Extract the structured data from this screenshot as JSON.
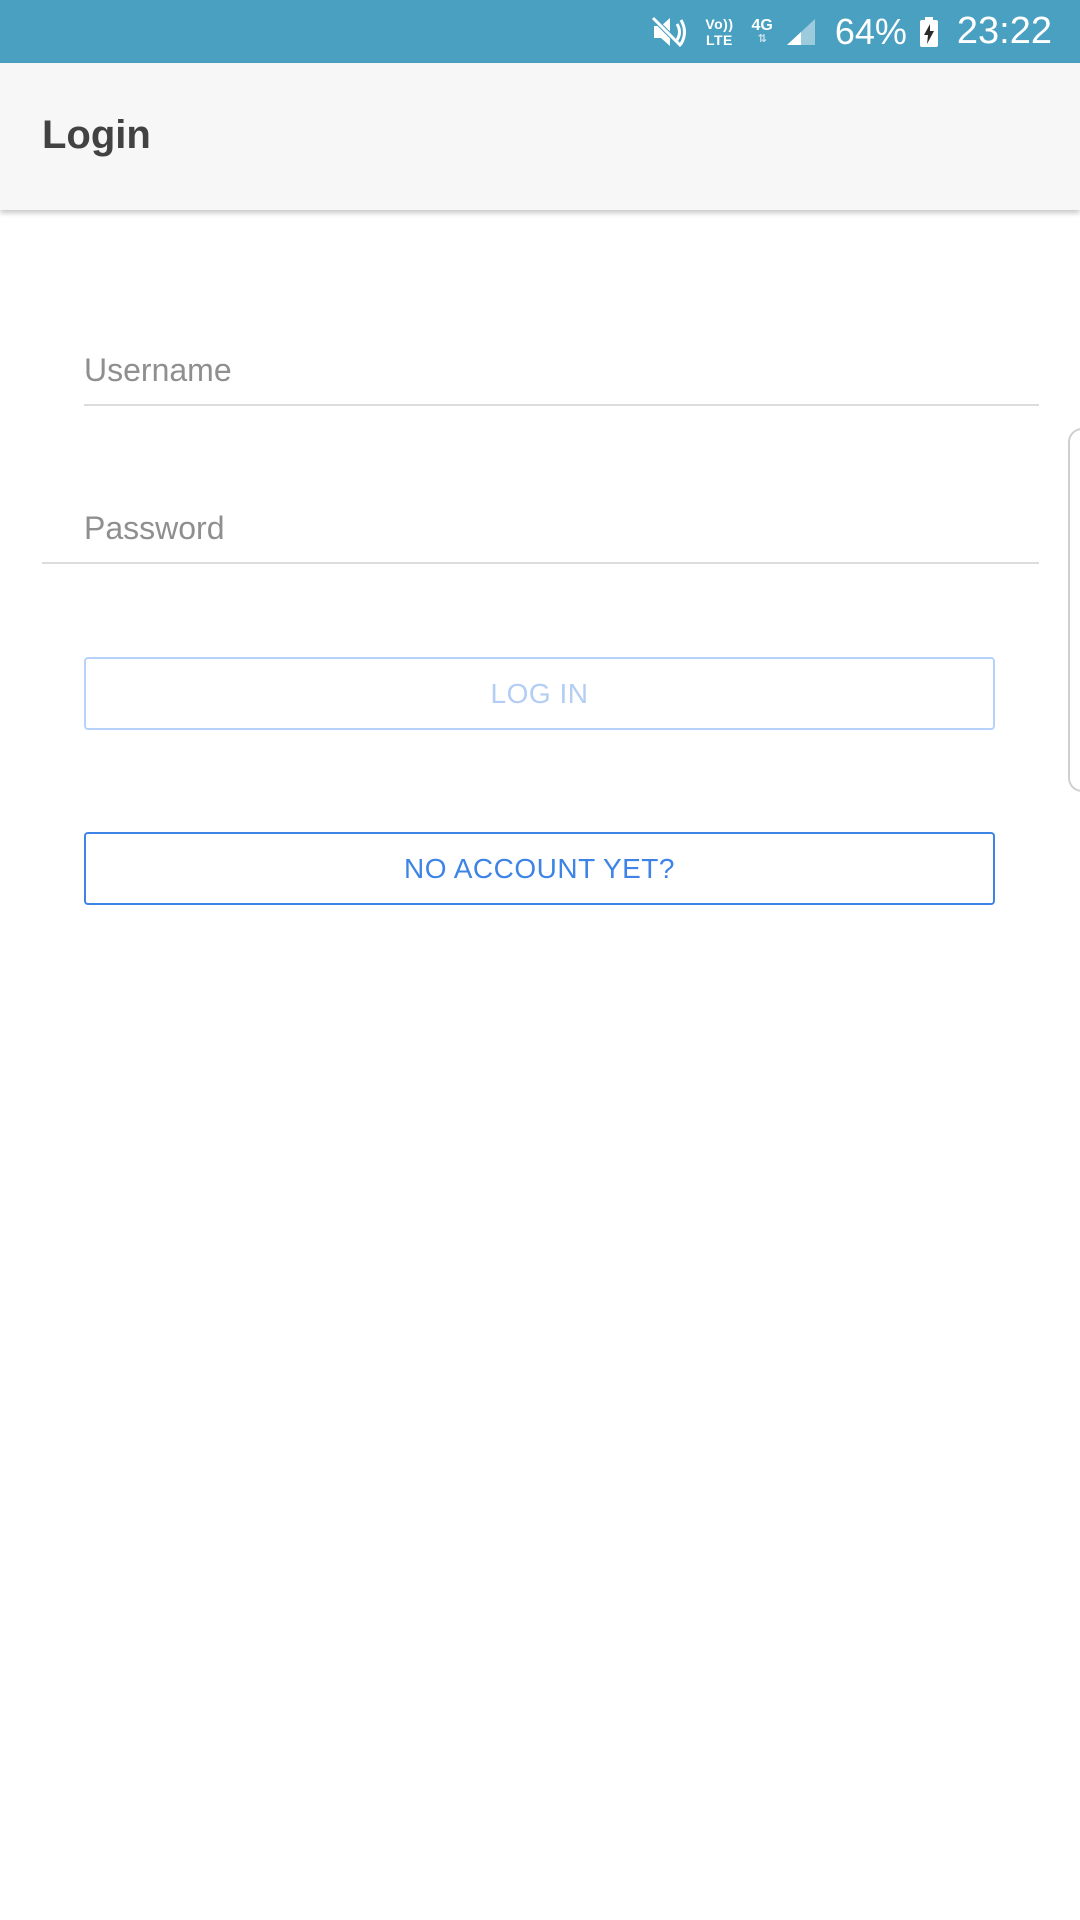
{
  "status_bar": {
    "volte_top": "Vo))",
    "volte_bottom": "LTE",
    "network": "4G",
    "network_arrows": "⇅",
    "battery": "64%",
    "time": "23:22",
    "color": "#4aa0c1"
  },
  "app_bar": {
    "title": "Login"
  },
  "form": {
    "username_placeholder": "Username",
    "username_value": "",
    "password_placeholder": "Password",
    "password_value": ""
  },
  "buttons": {
    "login_label": "LOG IN",
    "signup_label": "NO ACCOUNT YET?",
    "accent_color": "#3d84e6",
    "disabled_color": "#b3cdf5"
  }
}
